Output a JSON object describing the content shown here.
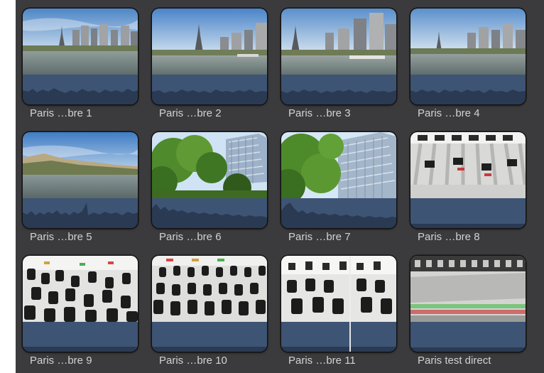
{
  "clips": [
    {
      "name": "Paris …bre 1",
      "thumbnail": "paris-seine-eiffel-skyline"
    },
    {
      "name": "Paris …bre 2",
      "thumbnail": "paris-seine-eiffel-skyline"
    },
    {
      "name": "Paris …bre 3",
      "thumbnail": "paris-seine-eiffel-skyline"
    },
    {
      "name": "Paris …bre 4",
      "thumbnail": "paris-seine-eiffel-skyline"
    },
    {
      "name": "Paris …bre 5",
      "thumbnail": "paris-riverbank-buildings"
    },
    {
      "name": "Paris …bre 6",
      "thumbnail": "trees-and-glass-tower"
    },
    {
      "name": "Paris …bre 7",
      "thumbnail": "trees-and-glass-tower"
    },
    {
      "name": "Paris …bre 8",
      "thumbnail": "mixing-console-faders"
    },
    {
      "name": "Paris …bre 9",
      "thumbnail": "mixing-console-knobs"
    },
    {
      "name": "Paris …bre 10",
      "thumbnail": "mixing-console-knobs"
    },
    {
      "name": "Paris …bre 11",
      "thumbnail": "mixing-console-knobs"
    },
    {
      "name": "Paris test direct",
      "thumbnail": "mixing-console-faders"
    }
  ],
  "colors": {
    "background": "#3b3b3d",
    "audio_waveform_bg": "#3e5474",
    "audio_waveform": "#2a3a52",
    "label": "#d2d2d2",
    "playhead": "#ececec"
  }
}
